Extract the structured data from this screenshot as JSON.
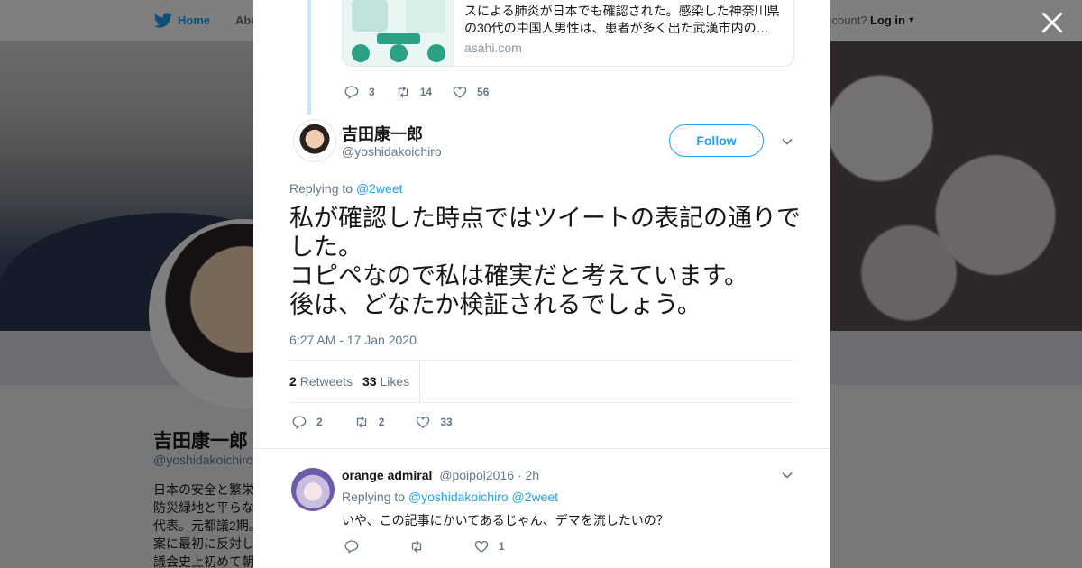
{
  "background": {
    "nav": {
      "home_label": "Home",
      "about_label": "Abo",
      "account_text": "ccount?",
      "login_label": "Log in"
    },
    "profile": {
      "name": "吉田康一郎",
      "handle": "@yoshidakoichiro",
      "bio_lines": [
        "日本の安全と繁栄",
        "防災緑地と平らな",
        "代表。元都議2期。",
        "案に最初に反対し",
        "議会史上初めて朝"
      ]
    }
  },
  "modal": {
    "quoted_card": {
      "title": "スによる肺炎が日本でも確認された。感染した神奈川県の30代の中国人男性は、患者が多く出た武漢市内の…",
      "domain": "asahi.com"
    },
    "parent_actions": {
      "replies": "3",
      "retweets": "14",
      "likes": "56"
    },
    "tweet": {
      "author_name": "吉田康一郎",
      "author_handle": "@yoshidakoichiro",
      "follow_label": "Follow",
      "replying_prefix": "Replying to",
      "replying_to": "@2weet",
      "text": "私が確認した時点ではツイートの表記の通りでした。\nコピペなので私は確実だと考えています。\n後は、どなたか検証されるでしょう。",
      "timestamp": "6:27 AM - 17 Jan 2020",
      "retweet_count": "2",
      "retweet_label": "Retweets",
      "like_count": "33",
      "like_label": "Likes",
      "actions": {
        "replies": "2",
        "retweets": "2",
        "likes": "33"
      }
    },
    "liker_avatar_colors": [
      "#a7b0ba",
      "#4a6a8a",
      "#3d5a3a",
      "#c8a070",
      "#b8b8b8",
      "#1f4a5a",
      "#d8c8a0",
      "#8a8a60",
      "#d0d8f0"
    ],
    "reply": {
      "name": "orange admiral",
      "handle": "@poipoi2016",
      "time": "· 2h",
      "replying_prefix": "Replying to",
      "replying_to_1": "@yoshidakoichiro",
      "replying_to_2": "@2weet",
      "text": "いや、この記事にかいてあるじゃん、デマを流したいの？",
      "actions": {
        "replies": "",
        "retweets": "",
        "likes": "1"
      }
    }
  },
  "colors": {
    "accent": "#1da1f2",
    "muted": "#657786",
    "overlay": "rgba(0,0,0,0.5)"
  }
}
